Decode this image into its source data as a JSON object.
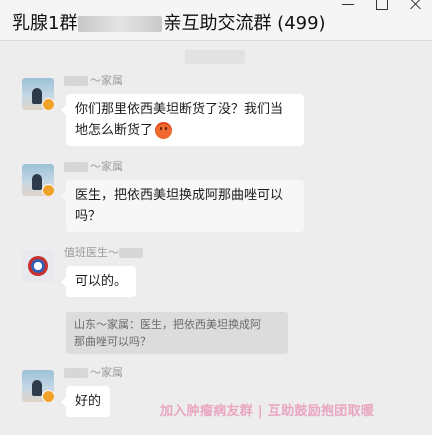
{
  "window": {
    "title_prefix": "乳腺1群",
    "title_suffix": "亲互助交流群 (499)"
  },
  "messages": [
    {
      "sender_suffix": "～家属",
      "text_line1": "你们那里依西美坦断货了没？我们当",
      "text_line2": "地怎么断货了",
      "emoji": "fire-emoji"
    },
    {
      "sender_suffix": "～家属",
      "text_line1": "医生，把依西美坦换成阿那曲唑可以",
      "text_line2": "吗？"
    },
    {
      "sender_prefix": "值班医生～",
      "text": "可以的。",
      "quote_line1": "山东～家属：医生，把依西美坦换成阿",
      "quote_line2": "那曲唑可以吗？"
    },
    {
      "sender_suffix": "～家属",
      "text": "好的"
    }
  ],
  "watermark": "加入肿瘤病友群 | 互助鼓励抱团取暖"
}
